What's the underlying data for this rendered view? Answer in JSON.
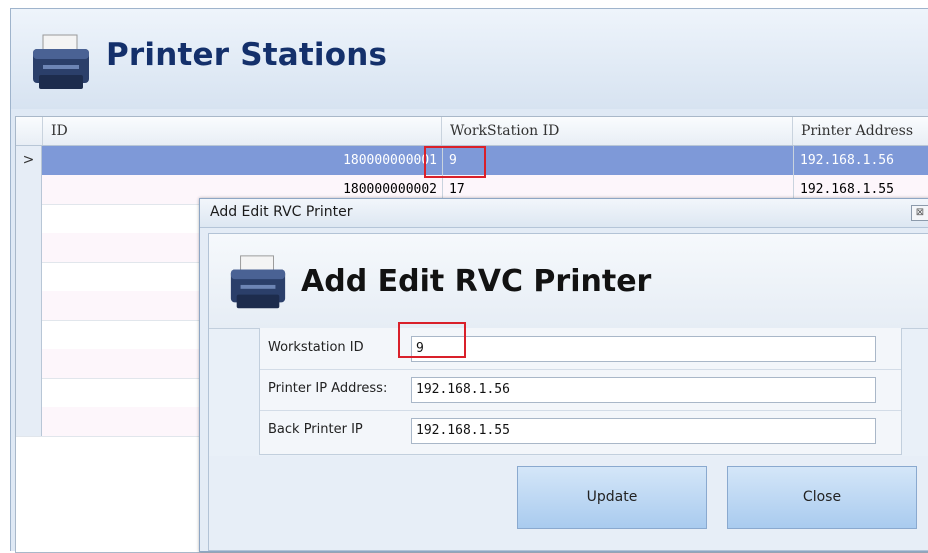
{
  "window": {
    "title": "Printer Stations"
  },
  "grid": {
    "columns": [
      "ID",
      "WorkStation ID",
      "Printer Address"
    ],
    "rows": [
      {
        "indicator": ">",
        "id": "180000000001",
        "workstation": "9",
        "address": "192.168.1.56",
        "selected": true
      },
      {
        "indicator": "",
        "id": "180000000002",
        "workstation": "17",
        "address": "192.168.1.55",
        "selected": false
      }
    ]
  },
  "dialog": {
    "title": "Add Edit RVC Printer",
    "close_glyph": "⊠",
    "heading": "Add Edit RVC Printer",
    "fields": [
      {
        "label": "Workstation ID",
        "value": "9"
      },
      {
        "label": "Printer IP Address:",
        "value": "192.168.1.56"
      },
      {
        "label": "Back Printer IP",
        "value": "192.168.1.55"
      }
    ],
    "buttons": {
      "update": "Update",
      "close": "Close"
    }
  },
  "icons": {
    "title_icon": "printer-icon",
    "dialog_icon": "printer-icon"
  },
  "colors": {
    "title_text": "#14306b",
    "selection": "#7e99d8",
    "highlight": "#d9202a",
    "button": "#a9cbef"
  }
}
